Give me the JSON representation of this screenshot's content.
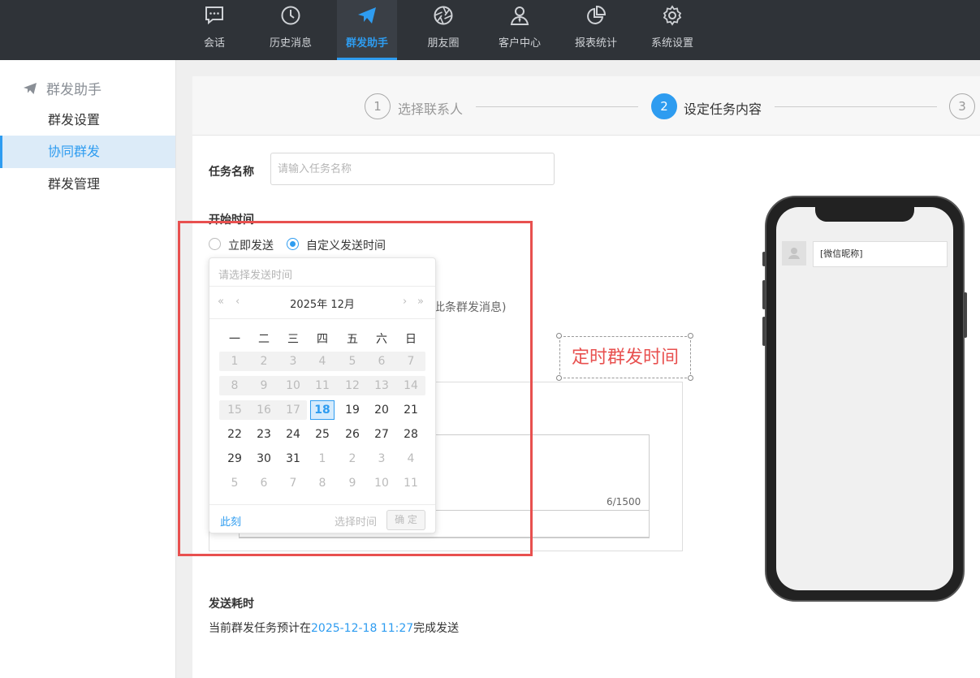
{
  "nav": {
    "items": [
      {
        "label": "会话",
        "icon": "chat-icon"
      },
      {
        "label": "历史消息",
        "icon": "clock-icon"
      },
      {
        "label": "群发助手",
        "icon": "paper-plane-icon"
      },
      {
        "label": "朋友圈",
        "icon": "aperture-icon"
      },
      {
        "label": "客户中心",
        "icon": "user-tie-icon"
      },
      {
        "label": "报表统计",
        "icon": "pie-chart-icon"
      },
      {
        "label": "系统设置",
        "icon": "gear-icon"
      }
    ],
    "active_index": 2,
    "accent_color": "#2e9cf0",
    "bg_color": "#2f3338"
  },
  "sidebar": {
    "title": "群发助手",
    "items": [
      {
        "label": "群发设置"
      },
      {
        "label": "协同群发"
      },
      {
        "label": "群发管理"
      }
    ],
    "active_index": 1
  },
  "steps": [
    {
      "num": "1",
      "label": "选择联系人"
    },
    {
      "num": "2",
      "label": "设定任务内容"
    },
    {
      "num": "3",
      "label": ""
    }
  ],
  "form": {
    "task_name_label": "任务名称",
    "task_name_placeholder": "请输入任务名称",
    "start_time_label": "开始时间",
    "radio_now": "立即发送",
    "radio_custom": "自定义发送时间",
    "hint_suffix": "此条群发消息)",
    "char_count": "6/1500",
    "duration_label": "发送耗时",
    "duration_prefix": "当前群发任务预计在",
    "duration_time": "2025-12-18 11:27",
    "duration_suffix": "完成发送"
  },
  "picker": {
    "placeholder": "请选择发送时间",
    "year_month": "2025年 12月",
    "prev_year": "«",
    "prev_month": "‹",
    "next_month": "›",
    "next_year": "»",
    "weekdays": [
      "一",
      "二",
      "三",
      "四",
      "五",
      "六",
      "日"
    ],
    "weeks": [
      [
        "1",
        "2",
        "3",
        "4",
        "5",
        "6",
        "7"
      ],
      [
        "8",
        "9",
        "10",
        "11",
        "12",
        "13",
        "14"
      ],
      [
        "15",
        "16",
        "17",
        "18",
        "19",
        "20",
        "21"
      ],
      [
        "22",
        "23",
        "24",
        "25",
        "26",
        "27",
        "28"
      ],
      [
        "29",
        "30",
        "31",
        "1",
        "2",
        "3",
        "4"
      ],
      [
        "5",
        "6",
        "7",
        "8",
        "9",
        "10",
        "11"
      ]
    ],
    "today": "18",
    "now_label": "此刻",
    "select_time_label": "选择时间",
    "ok_label": "确 定"
  },
  "annotation": {
    "text": "定时群发时间",
    "color": "#e8504f"
  },
  "phone": {
    "nickname": "[微信昵称]"
  }
}
